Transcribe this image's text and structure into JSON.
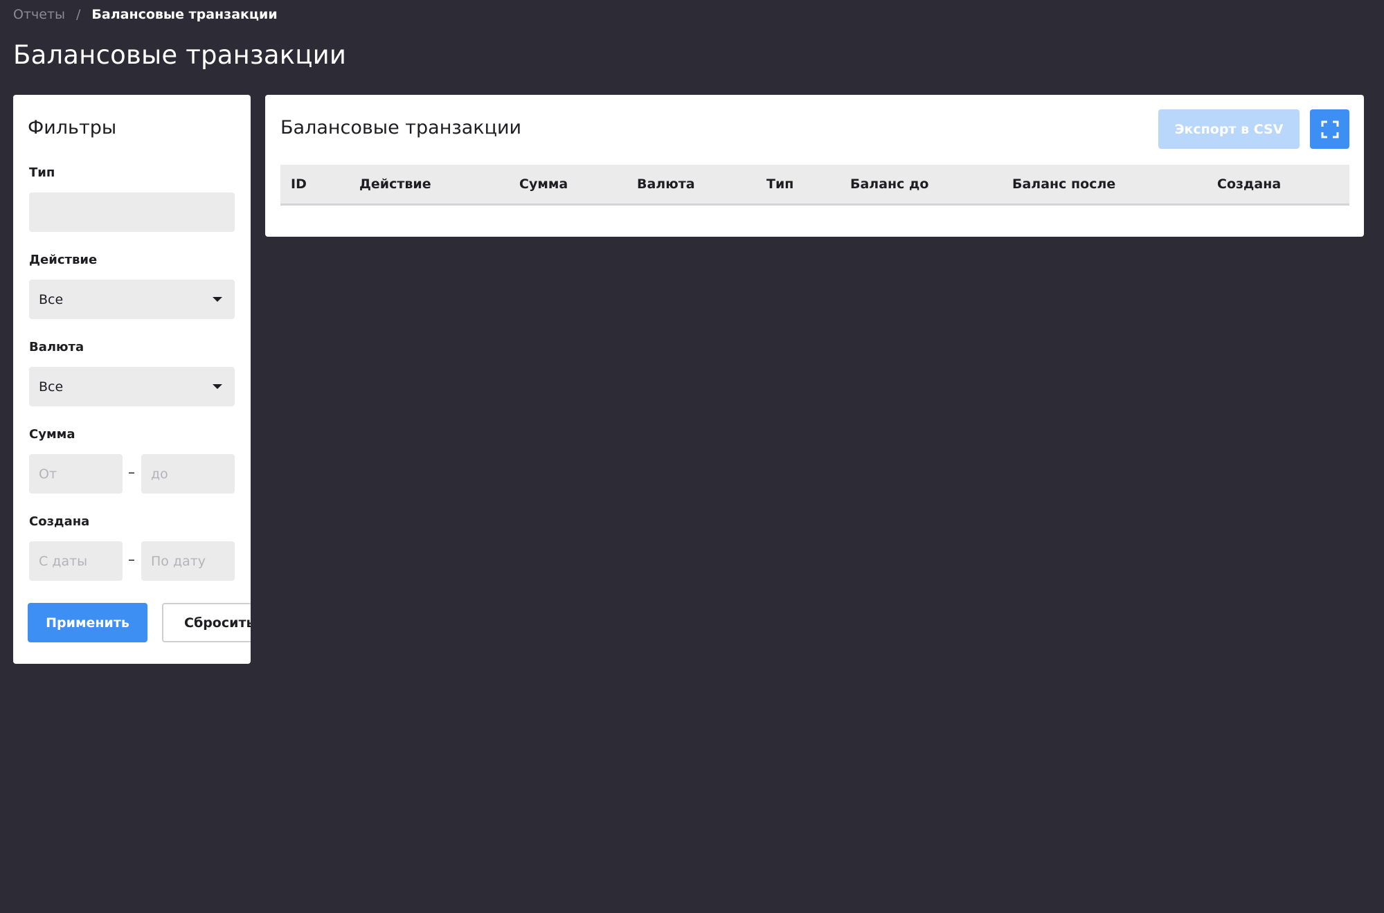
{
  "breadcrumb": {
    "parent": "Отчеты",
    "separator": "/",
    "current": "Балансовые транзакции"
  },
  "page": {
    "title": "Балансовые транзакции"
  },
  "filters": {
    "title": "Фильтры",
    "type": {
      "label": "Тип",
      "value": ""
    },
    "action": {
      "label": "Действие",
      "selected": "Все"
    },
    "currency": {
      "label": "Валюта",
      "selected": "Все"
    },
    "amount": {
      "label": "Сумма",
      "from_placeholder": "От",
      "to_placeholder": "до",
      "dash": "–"
    },
    "created": {
      "label": "Создана",
      "from_placeholder": "С даты",
      "to_placeholder": "По дату",
      "dash": "–"
    },
    "apply_label": "Применить",
    "reset_label": "Сбросить"
  },
  "table": {
    "title": "Балансовые транзакции",
    "export_label": "Экспорт в CSV",
    "columns": [
      "ID",
      "Действие",
      "Сумма",
      "Валюта",
      "Тип",
      "Баланс до",
      "Баланс после",
      "Создана"
    ],
    "rows": []
  },
  "colors": {
    "background": "#2d2b36",
    "accent": "#3d8ff4",
    "accent_disabled": "#b9d6fb",
    "field": "#ebebeb"
  },
  "icons": {
    "fullscreen": "fullscreen-icon",
    "select_caret": "caret-down-icon"
  }
}
